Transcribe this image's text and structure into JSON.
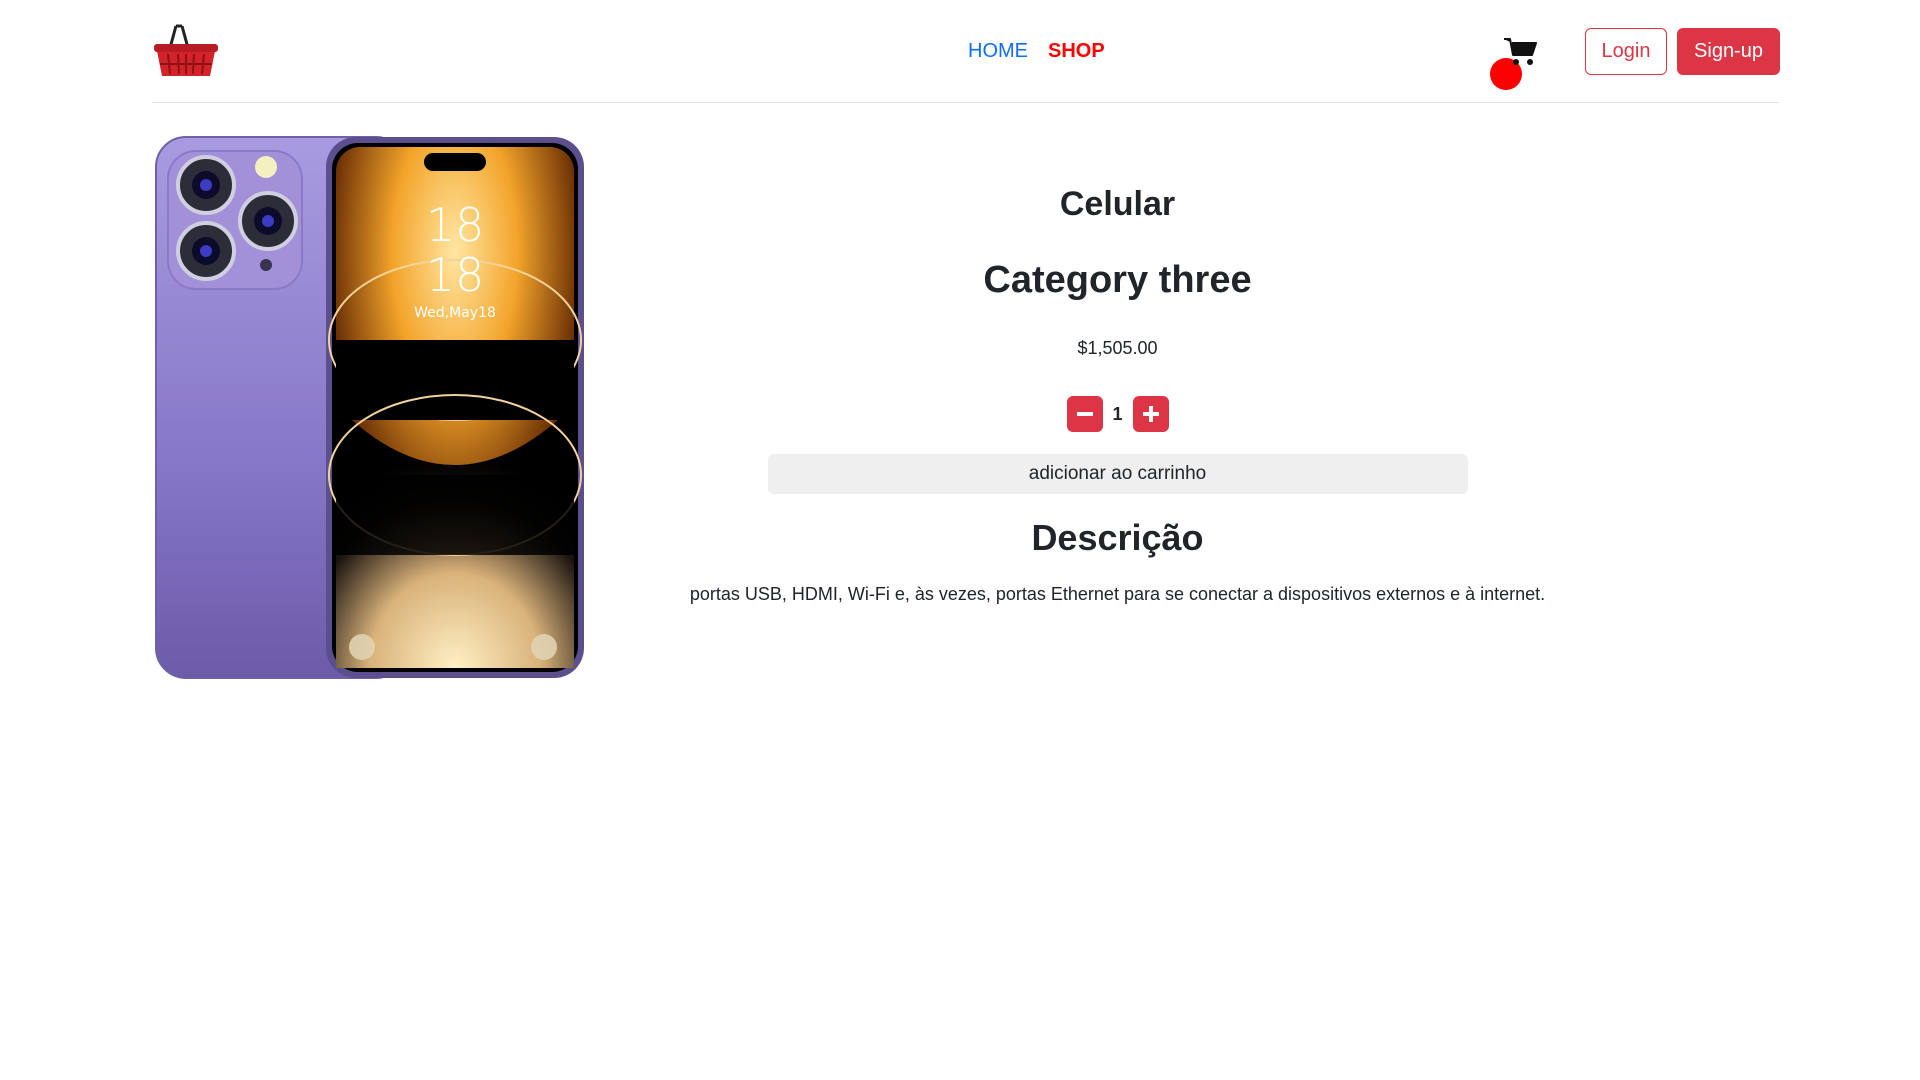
{
  "header": {
    "logo_icon": "shopping-basket-icon",
    "nav": [
      {
        "label": "HOME",
        "color": "#0d6efd"
      },
      {
        "label": "SHOP",
        "color": "#ff0000"
      }
    ],
    "cart_icon": "shopping-cart-icon",
    "login_label": "Login",
    "signup_label": "Sign-up"
  },
  "product": {
    "image_icon": "smartphone-product-image",
    "screen_time_hour": "18",
    "screen_time_minute": "18",
    "screen_date": "Wed,May18",
    "name": "Celular",
    "category": "Category three",
    "price": "$1,505.00",
    "quantity": "1",
    "add_to_cart_label": "adicionar ao carrinho",
    "description_title": "Descrição",
    "description": "portas USB, HDMI, Wi-Fi e, às vezes, portas Ethernet para se conectar a dispositivos externos e à internet."
  },
  "colors": {
    "accent": "#dc3545",
    "link": "#0d6efd",
    "shop": "#ff0000"
  }
}
